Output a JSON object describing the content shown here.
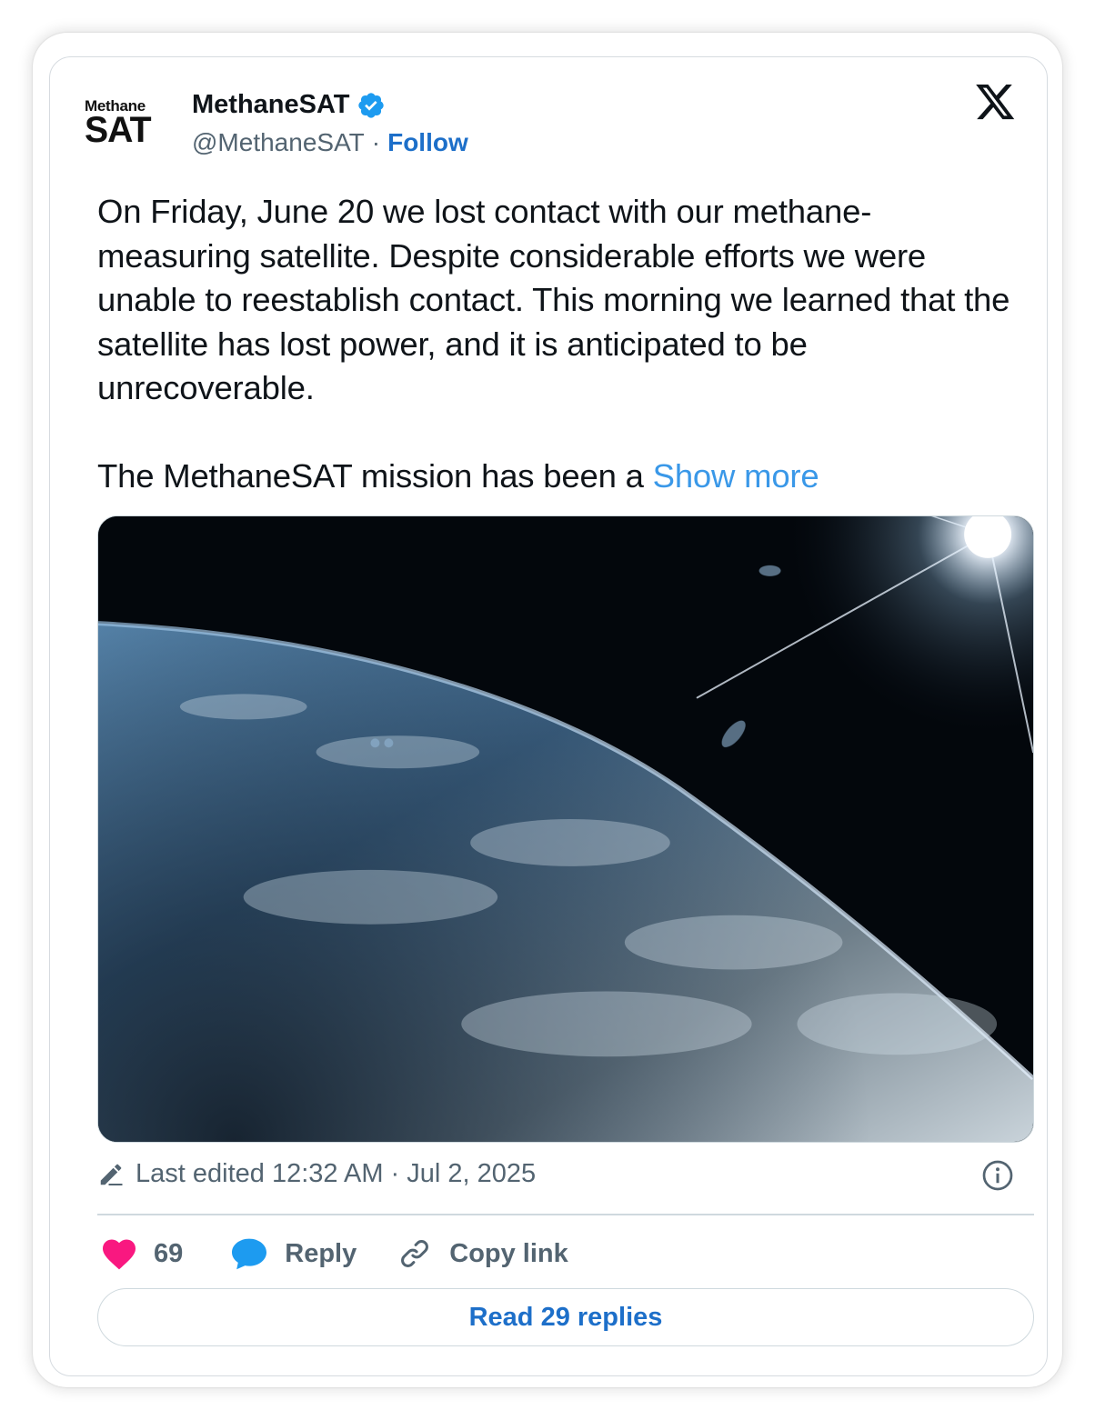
{
  "author": {
    "logo_line1": "Methane",
    "logo_line2": "SAT",
    "display_name": "MethaneSAT",
    "handle": "@MethaneSAT",
    "separator": "·",
    "follow_label": "Follow",
    "verified": true
  },
  "tweet": {
    "paragraph1": "On Friday, June 20 we lost contact with our methane-measuring satellite. Despite considerable efforts we were unable to reestablish contact. This morning we learned that the satellite has lost power, and it is anticipated to be unrecoverable.",
    "paragraph2": "The MethaneSAT mission has been a ",
    "show_more": "Show more"
  },
  "media": {
    "icon": "earth-from-space-photo"
  },
  "meta": {
    "edited_text": "Last edited 12:32 AM · Jul 2, 2025"
  },
  "actions": {
    "like_count": "69",
    "reply_label": "Reply",
    "copy_link_label": "Copy link",
    "read_replies_label": "Read 29 replies"
  },
  "colors": {
    "accent_blue": "#1d6fc9",
    "show_more_blue": "#3a98e8",
    "like_pink": "#f91880",
    "reply_blue": "#1d9bf0",
    "muted_text": "#536471",
    "text": "#0f1419"
  }
}
